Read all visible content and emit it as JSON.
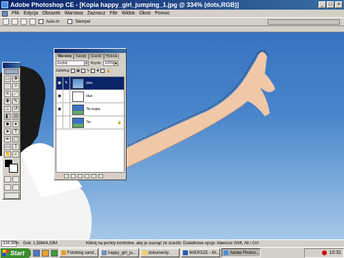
{
  "window": {
    "title": "Adobe Photoshop CE - [Kopia happy_girl_jumping_1.jpg @ 334% (dots,RGB)]",
    "controls": [
      "_",
      "□",
      "×"
    ]
  },
  "menu": [
    "Plik",
    "Edycja",
    "Obrazek",
    "Warstwa",
    "Zaznacz",
    "Filtr",
    "Widok",
    "Okno",
    "Pomoc"
  ],
  "options_bar": {
    "auto_label": "Auto-m",
    "stempel_label": "Stempel"
  },
  "layers_palette": {
    "tabs": [
      "Warstwy",
      "Kanały",
      "Ścieżki",
      "Historia"
    ],
    "blend_mode": "Zwykły",
    "opacity_label": "Krycie:",
    "opacity_value": "100%",
    "lock_label": "Zablokuj:",
    "layers": [
      {
        "name": "dots",
        "selected": true,
        "visible": true,
        "locked": false
      },
      {
        "name": "blue",
        "selected": false,
        "visible": true,
        "locked": false
      },
      {
        "name": "Tło kopia",
        "selected": false,
        "visible": true,
        "locked": false
      },
      {
        "name": "Tło",
        "selected": false,
        "visible": false,
        "locked": true
      }
    ]
  },
  "status_bar": {
    "zoom": "334,38%",
    "doc_size": "Dok: 1,58M/4,33M",
    "hint": "Kliknij na punkty kontrolne, aby je usunąć ze ścieżki. Dodatkowe opcje: klawisze Shift, Alt i Ctrl"
  },
  "taskbar": {
    "start_label": "Start",
    "tasks": [
      {
        "label": "Fotoblog sand...",
        "active": false
      },
      {
        "label": "happy_girl_ju...",
        "active": false
      },
      {
        "label": "dokumenty",
        "active": false
      },
      {
        "label": "WIERSZE - Mi...",
        "active": false
      },
      {
        "label": "Adobe Photos...",
        "active": true
      }
    ],
    "clock": "10:31"
  },
  "colors": {
    "titlebar": "#0a246a",
    "sky": "#4a86cc",
    "selection": "#0a246a"
  }
}
